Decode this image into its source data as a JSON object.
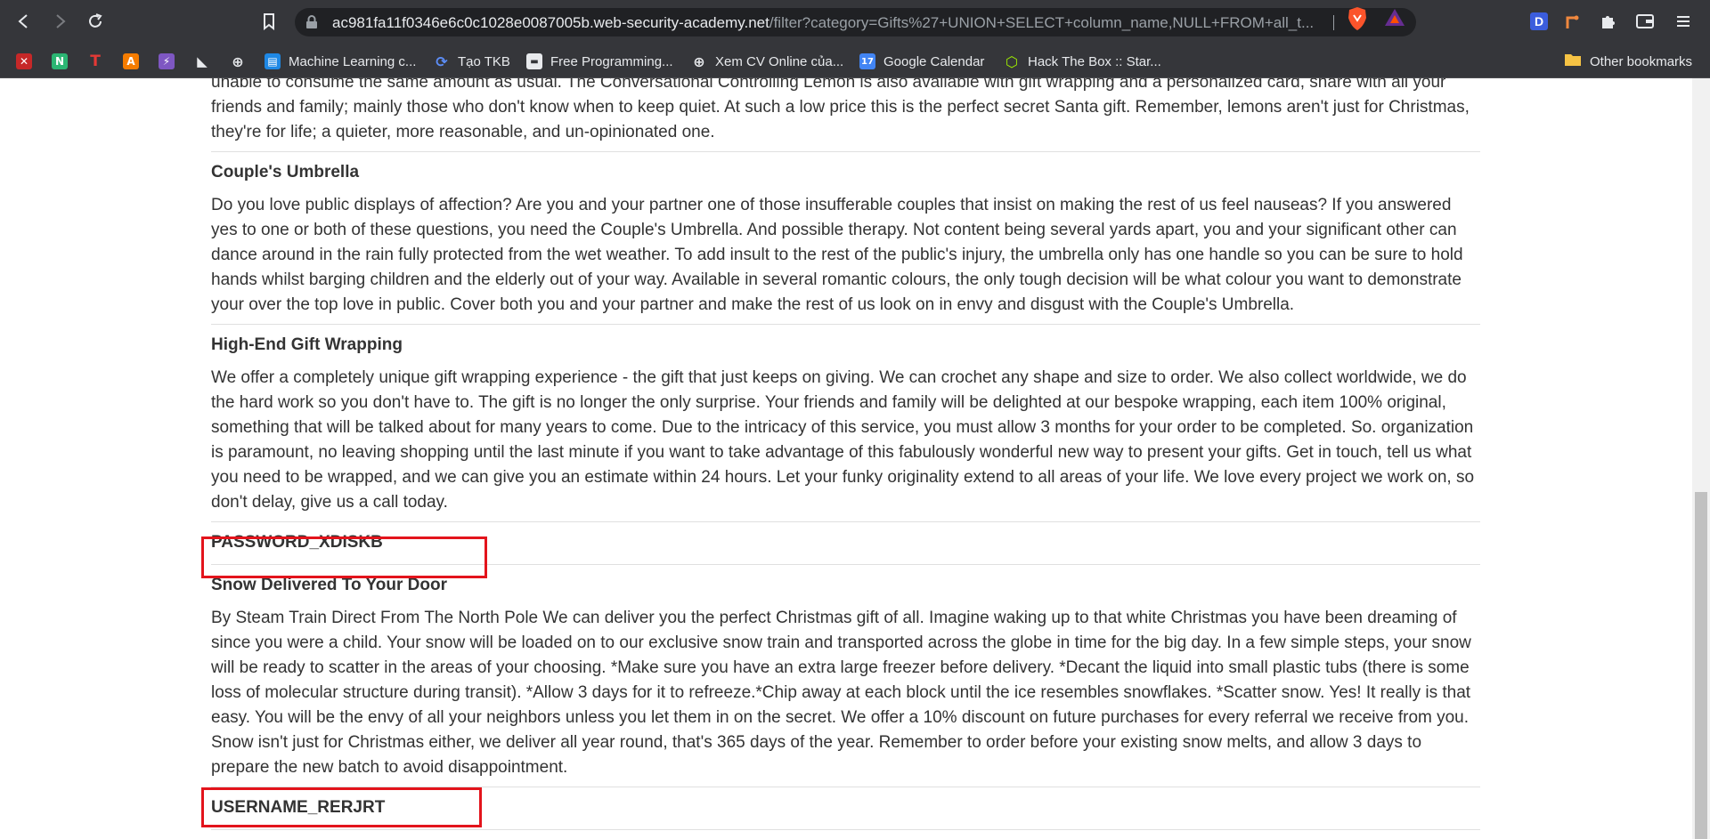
{
  "browser": {
    "url_host": "ac981fa11f0346e6c0c1028e0087005b.web-security-academy.net",
    "url_rest": "/filter?category=Gifts%27+UNION+SELECT+column_name,NULL+FROM+all_t...",
    "icons": {
      "back": "back-arrow-icon",
      "forward": "forward-arrow-icon",
      "reload": "reload-icon",
      "bookmark": "bookmark-icon",
      "lock": "lock-icon"
    },
    "extensions": [
      "D",
      "pen-tool",
      "puzzle",
      "wallet",
      "menu"
    ]
  },
  "bookmarks": {
    "items": [
      {
        "label": "",
        "color": "#c62828",
        "glyph": "✕"
      },
      {
        "label": "",
        "color": "#2bb673",
        "glyph": "N"
      },
      {
        "label": "",
        "color": "#35363a",
        "glyph": "T",
        "glyph_color": "#e53935"
      },
      {
        "label": "",
        "color": "#f57c00",
        "glyph": "A"
      },
      {
        "label": "",
        "color": "#7e57c2",
        "glyph": "⚡"
      },
      {
        "label": "",
        "color": "#35363a",
        "glyph": "◣",
        "glyph_color": "#e8eaed"
      },
      {
        "label": "",
        "color": "#35363a",
        "glyph": "⊕",
        "glyph_color": "#e8eaed"
      },
      {
        "label": "Machine Learning c...",
        "color": "#1e88e5",
        "glyph": "▤"
      },
      {
        "label": "Tạo TKB",
        "color": "#35363a",
        "glyph": "⟳",
        "glyph_color": "#5c8df6"
      },
      {
        "label": "Free Programming...",
        "color": "#35363a",
        "glyph": "▬",
        "glyph_color": "#e8eaed"
      },
      {
        "label": "Xem CV Online của...",
        "color": "#35363a",
        "glyph": "⊕",
        "glyph_color": "#e8eaed"
      },
      {
        "label": "Google Calendar",
        "color": "#4285f4",
        "glyph": "17"
      },
      {
        "label": "Hack The Box :: Star...",
        "color": "#35363a",
        "glyph": "⬡",
        "glyph_color": "#9fef00"
      }
    ],
    "other": "Other bookmarks"
  },
  "page": {
    "intro_text": "unable to consume the same amount as usual. The Conversational Controlling Lemon is also available with gift wrapping and a personalized card, share with all your friends and family; mainly those who don't know when to keep quiet. At such a low price this is the perfect secret Santa gift. Remember, lemons aren't just for Christmas, they're for life; a quieter, more reasonable, and un-opinionated one.",
    "items": [
      {
        "title": "Couple's Umbrella",
        "description": "Do you love public displays of affection? Are you and your partner one of those insufferable couples that insist on making the rest of us feel nauseas? If you answered yes to one or both of these questions, you need the Couple's Umbrella. And possible therapy. Not content being several yards apart, you and your significant other can dance around in the rain fully protected from the wet weather. To add insult to the rest of the public's injury, the umbrella only has one handle so you can be sure to hold hands whilst barging children and the elderly out of your way. Available in several romantic colours, the only tough decision will be what colour you want to demonstrate your over the top love in public. Cover both you and your partner and make the rest of us look on in envy and disgust with the Couple's Umbrella."
      },
      {
        "title": "High-End Gift Wrapping",
        "description": "We offer a completely unique gift wrapping experience - the gift that just keeps on giving. We can crochet any shape and size to order. We also collect worldwide, we do the hard work so you don't have to. The gift is no longer the only surprise. Your friends and family will be delighted at our bespoke wrapping, each item 100% original, something that will be talked about for many years to come. Due to the intricacy of this service, you must allow 3 months for your order to be completed. So. organization is paramount, no leaving shopping until the last minute if you want to take advantage of this fabulously wonderful new way to present your gifts. Get in touch, tell us what you need to be wrapped, and we can give you an estimate within 24 hours. Let your funky originality extend to all areas of your life. We love every project we work on, so don't delay, give us a call today."
      },
      {
        "title": "PASSWORD_XDISKB",
        "description": ""
      },
      {
        "title": "Snow Delivered To Your Door",
        "description": "By Steam Train Direct From The North Pole We can deliver you the perfect Christmas gift of all. Imagine waking up to that white Christmas you have been dreaming of since you were a child. Your snow will be loaded on to our exclusive snow train and transported across the globe in time for the big day. In a few simple steps, your snow will be ready to scatter in the areas of your choosing. *Make sure you have an extra large freezer before delivery. *Decant the liquid into small plastic tubs (there is some loss of molecular structure during transit). *Allow 3 days for it to refreeze.*Chip away at each block until the ice resembles snowflakes. *Scatter snow. Yes! It really is that easy. You will be the envy of all your neighbors unless you let them in on the secret. We offer a 10% discount on future purchases for every referral we receive from you. Snow isn't just for Christmas either, we deliver all year round, that's 365 days of the year. Remember to order before your existing snow melts, and allow 3 days to prepare the new batch to avoid disappointment."
      },
      {
        "title": "USERNAME_RERJRT",
        "description": ""
      }
    ]
  },
  "colors": {
    "chrome_bg": "#35363a",
    "omnibox_bg": "#202124",
    "highlight": "#e3141c",
    "text": "#333333"
  }
}
